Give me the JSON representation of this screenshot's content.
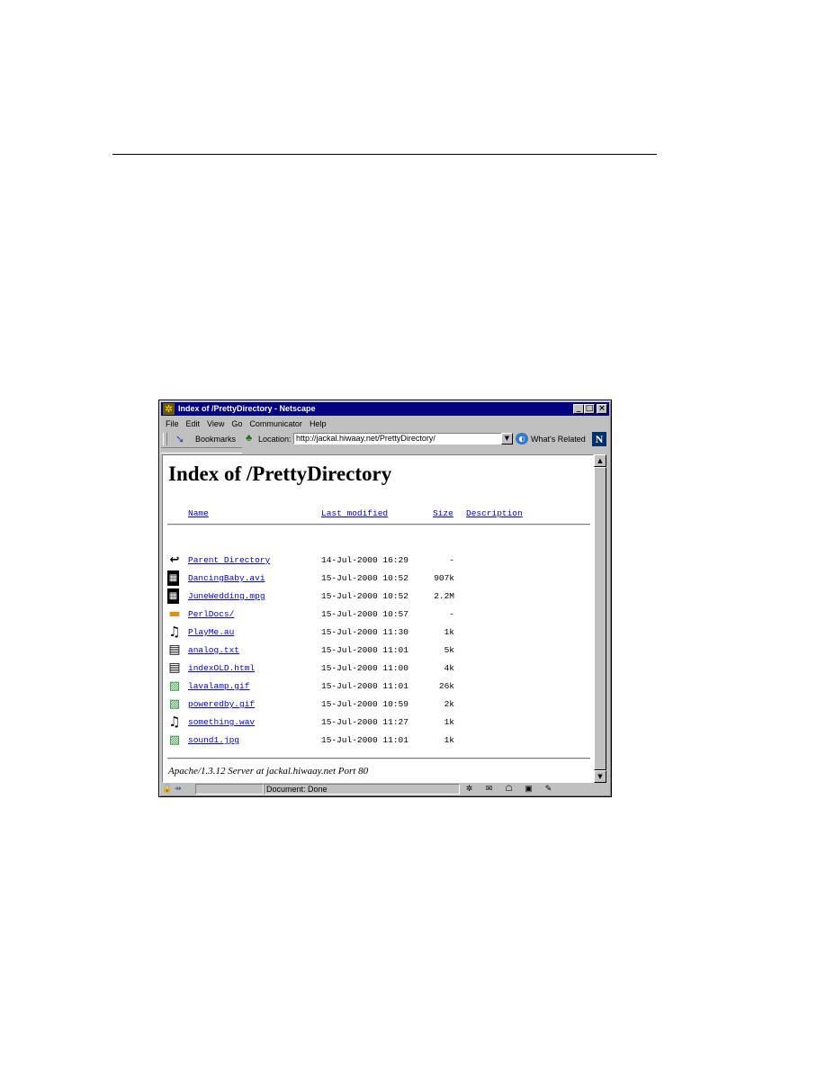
{
  "window": {
    "title": "Index of /PrettyDirectory - Netscape",
    "controls": {
      "minimize": "_",
      "maximize": "□",
      "close": "×"
    }
  },
  "menu": [
    "File",
    "Edit",
    "View",
    "Go",
    "Communicator",
    "Help"
  ],
  "toolbar": {
    "bookmarks_label": "Bookmarks",
    "location_label": "Location:",
    "url": "http://jackal.hiwaay.net/PrettyDirectory/",
    "whats_related_label": "What's Related",
    "brand_letter": "N"
  },
  "page": {
    "heading": "Index of /PrettyDirectory",
    "columns": {
      "name": "Name",
      "modified": "Last modified",
      "size": "Size",
      "description": "Description"
    },
    "rows": [
      {
        "icon": "back-arrow-icon",
        "name": "Parent Directory",
        "modified": "14-Jul-2000 16:29",
        "size": "-"
      },
      {
        "icon": "movie-icon",
        "name": "DancingBaby.avi",
        "modified": "15-Jul-2000 10:52",
        "size": "907k"
      },
      {
        "icon": "movie-icon",
        "name": "JuneWedding.mpg",
        "modified": "15-Jul-2000 10:52",
        "size": "2.2M"
      },
      {
        "icon": "folder-icon",
        "name": "PerlDocs/",
        "modified": "15-Jul-2000 10:57",
        "size": "-"
      },
      {
        "icon": "sound-icon",
        "name": "PlayMe.au",
        "modified": "15-Jul-2000 11:30",
        "size": "1k"
      },
      {
        "icon": "text-file-icon",
        "name": "analog.txt",
        "modified": "15-Jul-2000 11:01",
        "size": "5k"
      },
      {
        "icon": "text-file-icon",
        "name": "indexOLD.html",
        "modified": "15-Jul-2000 11:00",
        "size": "4k"
      },
      {
        "icon": "image-file-icon",
        "name": "lavalamp.gif",
        "modified": "15-Jul-2000 11:01",
        "size": "26k"
      },
      {
        "icon": "image-file-icon",
        "name": "poweredby.gif",
        "modified": "15-Jul-2000 10:59",
        "size": "2k"
      },
      {
        "icon": "sound-icon",
        "name": "something.wav",
        "modified": "15-Jul-2000 11:27",
        "size": "1k"
      },
      {
        "icon": "image-file-icon",
        "name": "sound1.jpg",
        "modified": "15-Jul-2000 11:01",
        "size": "1k"
      }
    ],
    "footer": "Apache/1.3.12 Server at jackal.hiwaay.net Port 80"
  },
  "status": {
    "text": "Document: Done"
  },
  "colors": {
    "titlebar": "#000080",
    "chrome": "#c0c0c0",
    "link": "#0000ee"
  }
}
